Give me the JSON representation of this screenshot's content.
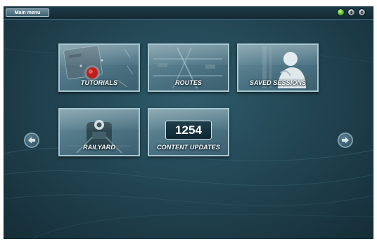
{
  "topbar": {
    "menu_label": "Main menu",
    "status_indicator_color": "#3ea61c"
  },
  "tiles": [
    {
      "label": "TUTORIALS",
      "icon": "red-button-panel-icon"
    },
    {
      "label": "ROUTES",
      "icon": "track-map-icon"
    },
    {
      "label": "SAVED SESSIONS",
      "icon": "person-silhouette-icon"
    },
    {
      "label": "RAILYARD",
      "icon": "locomotive-front-icon"
    },
    {
      "label": "CONTENT UPDATES",
      "counter": "1254",
      "icon": "counter-icon"
    }
  ],
  "navigation": {
    "prev_icon": "arrow-left-icon",
    "next_icon": "arrow-right-icon"
  },
  "colors": {
    "background": "#20414e",
    "tile_border": "#a6c7d1",
    "accent_red": "#c21d1d"
  }
}
